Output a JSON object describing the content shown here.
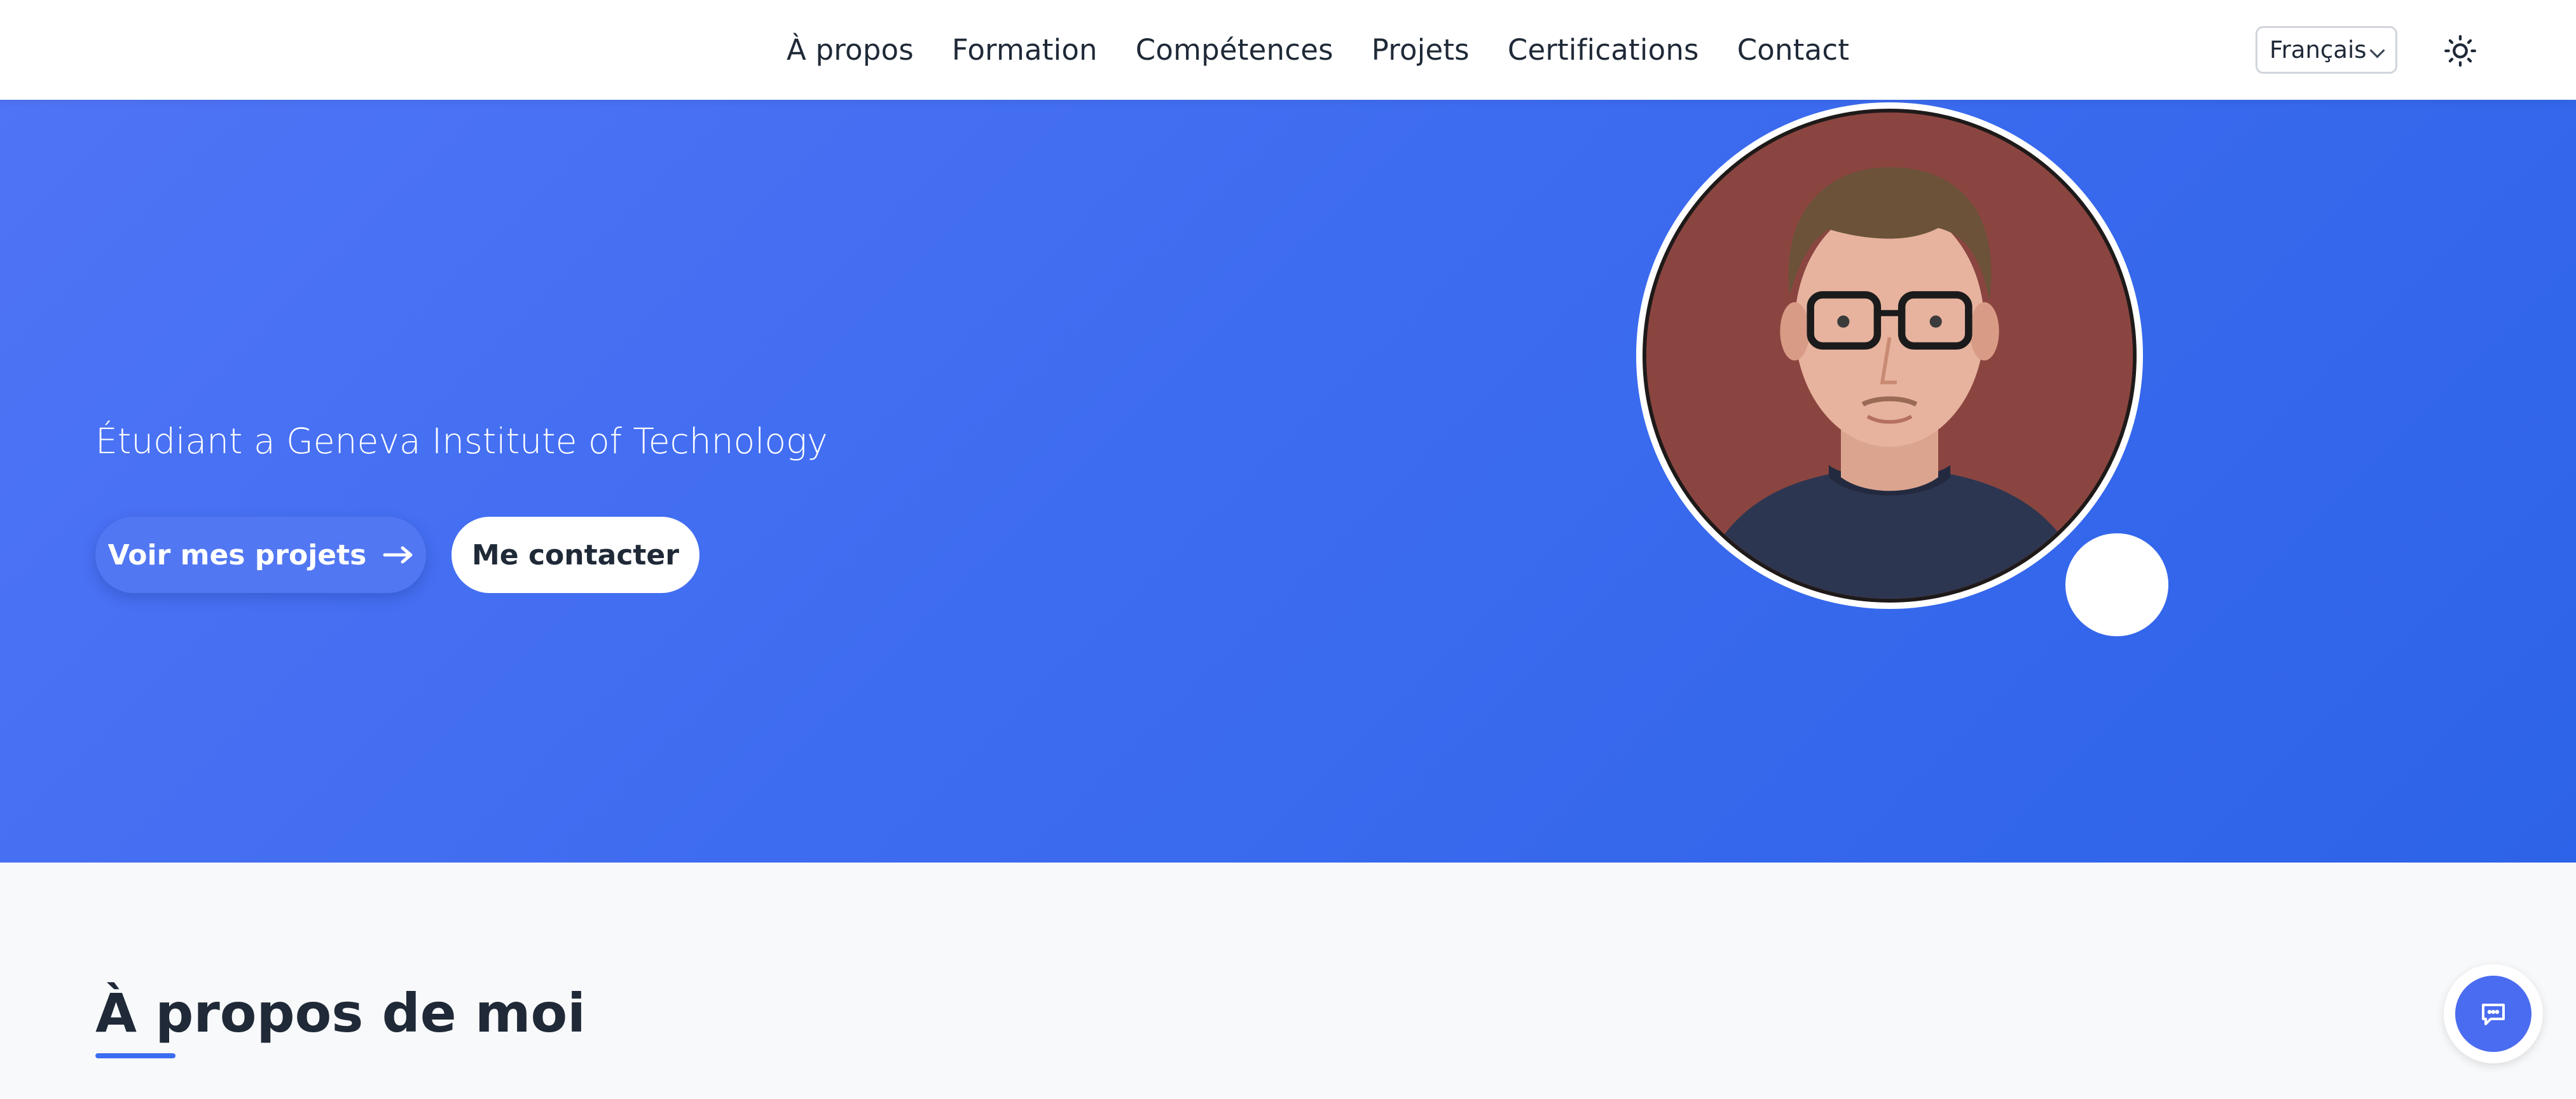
{
  "nav": {
    "links": [
      "À propos",
      "Formation",
      "Compétences",
      "Projets",
      "Certifications",
      "Contact"
    ],
    "language": "Français",
    "theme_icon": "sun-icon"
  },
  "hero": {
    "subtitle": "Étudiant a Geneva Institute of Technology",
    "primary_button": "Voir mes projets",
    "primary_button_icon": "arrow-right-icon",
    "secondary_button": "Me contacter",
    "colors": {
      "gradient_start": "#4f74f5",
      "gradient_end": "#2d63e8"
    }
  },
  "about": {
    "title": "À propos de moi",
    "accent_color": "#3b6ef0"
  },
  "chat": {
    "icon": "chat-bubble-icon"
  }
}
